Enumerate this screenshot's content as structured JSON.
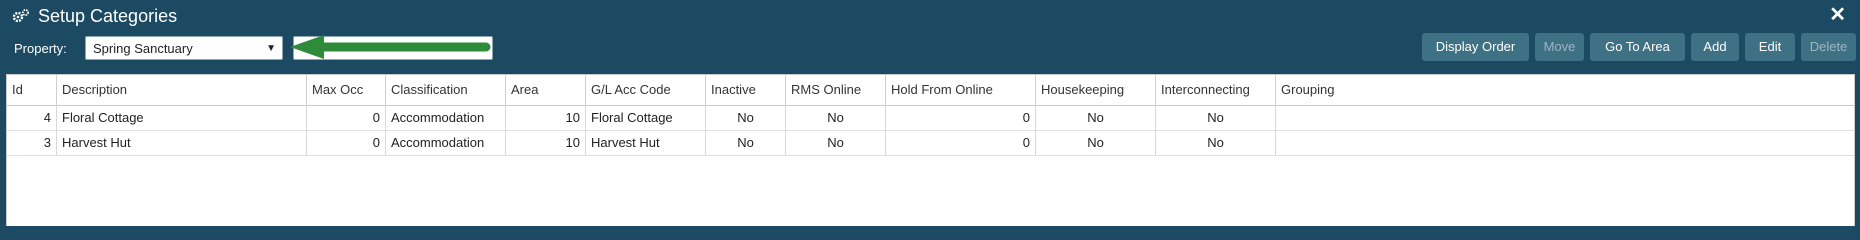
{
  "window": {
    "title": "Setup Categories",
    "title_icon": "gears-icon",
    "close_glyph": "✕"
  },
  "toolbar": {
    "property_label": "Property:",
    "property_value": "Spring Sanctuary",
    "search_value": "",
    "buttons": [
      "Display Order",
      "Move",
      "Go To Area",
      "Add",
      "Edit",
      "Delete"
    ],
    "disabled_buttons": [
      "Move",
      "Delete"
    ]
  },
  "table": {
    "columns": [
      "Id",
      "Description",
      "Max Occ",
      "Classification",
      "Area",
      "G/L Acc Code",
      "Inactive",
      "RMS Online",
      "Hold From Online",
      "Housekeeping",
      "Interconnecting",
      "Grouping"
    ],
    "rows": [
      [
        "4",
        "Floral Cottage",
        "0",
        "Accommodation",
        "10",
        "Floral Cottage",
        "No",
        "No",
        "0",
        "No",
        "No",
        ""
      ],
      [
        "3",
        "Harvest Hut",
        "0",
        "Accommodation",
        "10",
        "Harvest Hut",
        "No",
        "No",
        "0",
        "No",
        "No",
        ""
      ]
    ]
  },
  "colors": {
    "header_bg": "#1c4a63",
    "button_bg": "#3e7184",
    "annotation_arrow": "#2e8b3a"
  }
}
